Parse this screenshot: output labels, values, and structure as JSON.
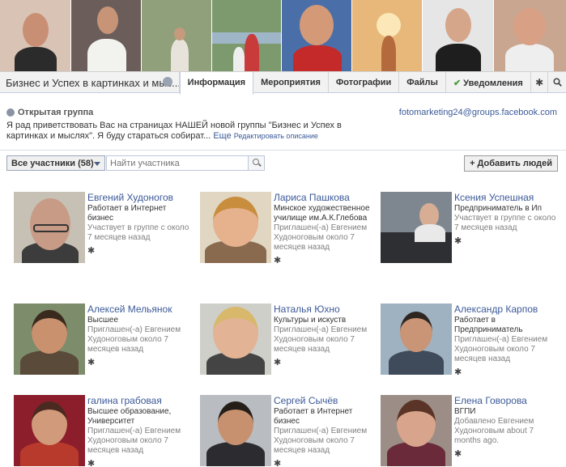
{
  "tabs": {
    "group_name": "Бизнес и Успех в картинках и мыс...",
    "info": "Информация",
    "events": "Мероприятия",
    "photos": "Фотографии",
    "files": "Файлы",
    "notifications": "Уведомления",
    "check_icon": "✔",
    "settings_icon": "gear-icon",
    "search_icon": "search-icon"
  },
  "group": {
    "type": "Открытая группа",
    "email": "fotomarketing24@groups.facebook.com",
    "description": "Я рад приветствовать Вас на страницах НАШЕЙ новой группы \"Бизнес и Успех в картинках и мыслях\". Я буду стараться собират...",
    "more_link": "Еще",
    "edit_link": "Редактировать описание"
  },
  "toolbar": {
    "members_filter": "Все участники (58)",
    "search_placeholder": "Найти участника",
    "add_people": "+ Добавить людей"
  },
  "members": [
    {
      "name": "Евгений Худоногов",
      "info": "Работает в Интернет бизнес",
      "meta": "Участвует в группе с около 7 месяцев назад"
    },
    {
      "name": "Лариса Пашкова",
      "info": "Минское художественное училище им.А.К.Глебова",
      "meta": "Приглашен(-а) Евгением Худоноговым около 7 месяцев назад"
    },
    {
      "name": "Ксения Успешная",
      "info": "Предприниматель в Ип",
      "meta": "Участвует в группе с около 7 месяцев назад"
    },
    {
      "name": "Алексей Мельянок",
      "info": "Высшее",
      "meta": "Приглашен(-а) Евгением Худоноговым около 7 месяцев назад"
    },
    {
      "name": "Наталья Юхно",
      "info": "Культуры и искуств",
      "meta": "Приглашен(-а) Евгением Худоноговым около 7 месяцев назад"
    },
    {
      "name": "Александр Карпов",
      "info": "Работает в Предприниматель",
      "meta": "Приглашен(-а) Евгением Худоноговым около 7 месяцев назад"
    },
    {
      "name": "галина грабовая",
      "info": "Высшее образование, Университет",
      "meta": "Приглашен(-а) Евгением Худоноговым около 7 месяцев назад"
    },
    {
      "name": "Сергей Сычёв",
      "info": "Работает в Интернет бизнес",
      "meta": "Приглашен(-а) Евгением Худоноговым около 7 месяцев назад"
    },
    {
      "name": "Елена Говорова",
      "info": "ВГПИ",
      "meta": "Добавлено Евгением Худоноговым about 7 months ago."
    }
  ],
  "gear_glyph": "✱",
  "colors": {
    "link": "#3b5998",
    "border": "#d8dfea"
  }
}
